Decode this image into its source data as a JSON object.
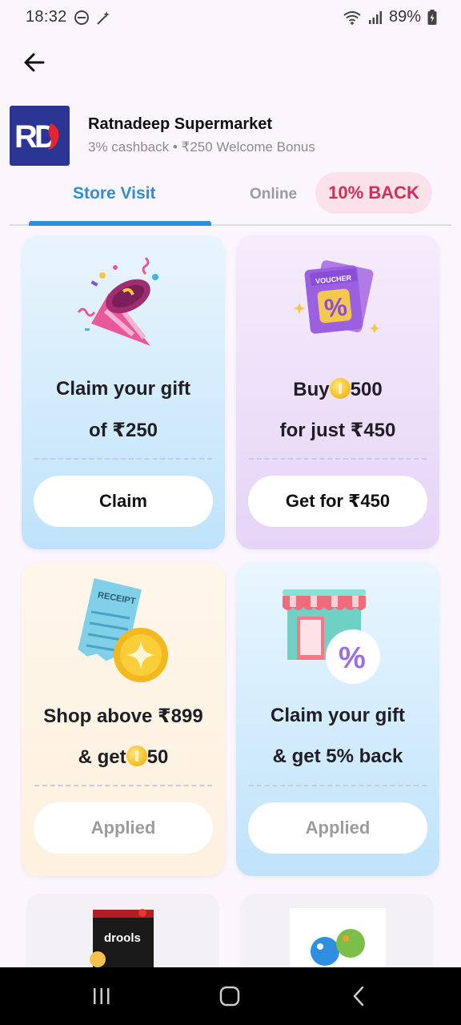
{
  "status_bar": {
    "time": "18:32",
    "battery": "89%"
  },
  "header": {
    "store_name": "Ratnadeep Supermarket",
    "store_subtitle": "3% cashback • ₹250 Welcome Bonus",
    "logo_text": "RD"
  },
  "tabs": {
    "store_visit": "Store Visit",
    "online": "Online",
    "cashback_badge": "10% BACK",
    "active": "Store Visit"
  },
  "offers": [
    {
      "line1": "Claim your gift",
      "line2": "of ₹250",
      "button": "Claim",
      "state": "active",
      "icon": "party-popper-icon"
    },
    {
      "line1_prefix": "Buy",
      "line1_suffix": "500",
      "line2": "for just ₹450",
      "button": "Get for ₹450",
      "state": "active",
      "icon": "voucher-icon"
    },
    {
      "line1": "Shop above ₹899",
      "line2_prefix": "& get",
      "line2_suffix": "50",
      "button": "Applied",
      "state": "applied",
      "icon": "receipt-coin-icon"
    },
    {
      "line1": "Claim your gift",
      "line2": "& get 5% back",
      "button": "Applied",
      "state": "applied",
      "icon": "store-percent-icon"
    }
  ],
  "products": [
    {
      "icon": "dog-food-pack-icon",
      "brand": "drools"
    },
    {
      "icon": "pet-toy-balls-icon"
    }
  ],
  "colors": {
    "accent_blue": "#2e8fd6",
    "badge_pink": "#d42d5b",
    "badge_bg": "#fbe2ea",
    "logo_bg": "#2b3694"
  }
}
